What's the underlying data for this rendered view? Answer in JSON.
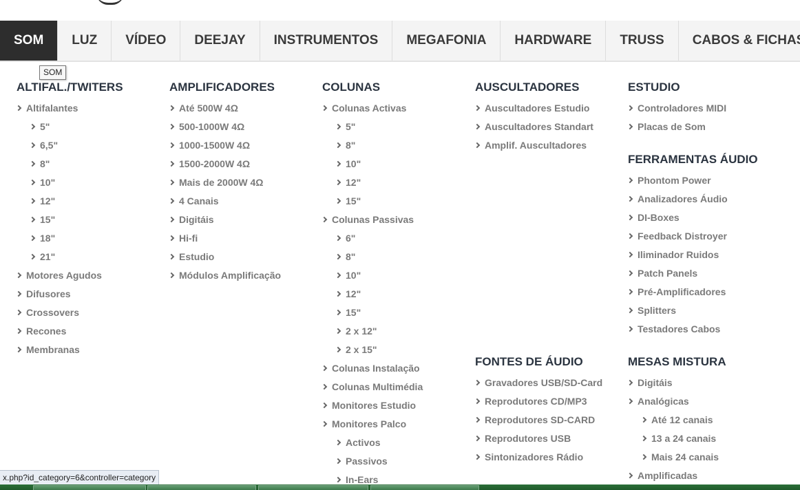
{
  "nav": {
    "tabs": [
      "SOM",
      "LUZ",
      "VÍDEO",
      "DEEJAY",
      "INSTRUMENTOS",
      "MEGAFONIA",
      "HARDWARE",
      "TRUSS",
      "CABOS & FICHAS"
    ],
    "active": "SOM"
  },
  "tooltip": "SOM",
  "menu": {
    "altifal": {
      "heading": "ALTIFAL./TWITERS",
      "items": [
        "Altifalantes",
        "5\"",
        "6,5\"",
        "8\"",
        "10\"",
        "12\"",
        "15\"",
        "18\"",
        "21\"",
        "Motores Agudos",
        "Difusores",
        "Crossovers",
        "Recones",
        "Membranas"
      ]
    },
    "amplificadores": {
      "heading": "AMPLIFICADORES",
      "items": [
        "Até 500W 4Ω",
        "500-1000W 4Ω",
        "1000-1500W 4Ω",
        "1500-2000W 4Ω",
        "Mais de 2000W 4Ω",
        "4 Canais",
        "Digitáis",
        "Hi-fi",
        "Estudio",
        "Módulos Amplificação"
      ]
    },
    "colunas": {
      "heading": "COLUNAS",
      "items": [
        "Colunas Activas",
        "5\"",
        "8\"",
        "10\"",
        "12\"",
        "15\"",
        "Colunas Passivas",
        "6\"",
        "8\"",
        "10\"",
        "12\"",
        "15\"",
        "2 x 12\"",
        "2 x 15\"",
        "Colunas Instalação",
        "Colunas Multimédia",
        "Monitores Estudio",
        "Monitores Palco",
        "Activos",
        "Passivos",
        "In-Ears"
      ]
    },
    "auscultadores": {
      "heading": "AUSCULTADORES",
      "items": [
        "Auscultadores Estudio",
        "Auscultadores Standart",
        "Amplif. Auscultadores"
      ]
    },
    "fontes": {
      "heading": "FONTES DE ÁUDIO",
      "items": [
        "Gravadores USB/SD-Card",
        "Reprodutores CD/MP3",
        "Reprodutores SD-CARD",
        "Reprodutores USB",
        "Sintonizadores Rádio"
      ]
    },
    "estudio": {
      "heading": "ESTUDIO",
      "items": [
        "Controladores MIDI",
        "Placas de Som"
      ]
    },
    "ferramentas": {
      "heading": "FERRAMENTAS ÁUDIO",
      "items": [
        "Phontom Power",
        "Analizadores Áudio",
        "DI-Boxes",
        "Feedback Distroyer",
        "Iliminador Ruidos",
        "Patch Panels",
        "Pré-Amplificadores",
        "Splitters",
        "Testadores Cabos"
      ]
    },
    "mesas": {
      "heading": "MESAS MISTURA",
      "items": [
        "Digitáis",
        "Analógicas",
        "Até 12 canais",
        "13 a 24 canais",
        "Mais 24 canais",
        "Amplificadas"
      ]
    }
  },
  "status_url": "x.php?id_category=6&controller=category",
  "icons": {
    "chevron": "chevron-right-icon"
  },
  "colors": {
    "nav_active_bg": "#2d2d2d",
    "nav_bg": "#f4f4f4",
    "heading": "#2b3440",
    "item": "#7a7a7a"
  }
}
